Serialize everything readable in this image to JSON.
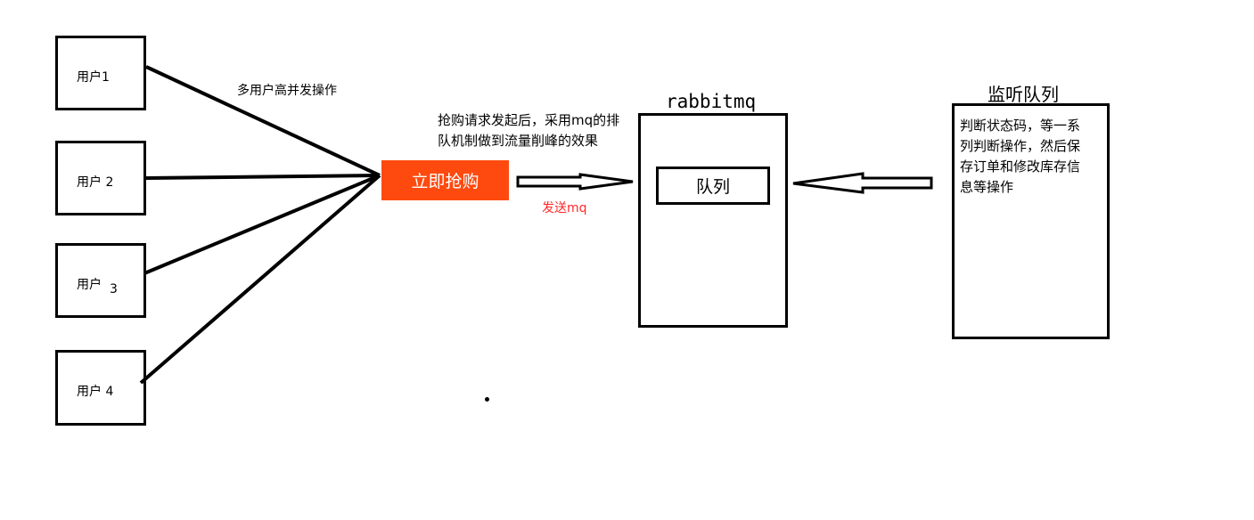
{
  "users": [
    {
      "label": "用户1"
    },
    {
      "label": "用户 2"
    },
    {
      "label": "用户",
      "suffix": "3"
    },
    {
      "label": "用户 4"
    }
  ],
  "concurrency_label": "多用户高并发操作",
  "buy_button_label": "立即抢购",
  "request_note": [
    "抢购请求发起后，采用mq的排",
    "队机制做到流量削峰的效果"
  ],
  "send_mq_label": "发送mq",
  "rabbitmq": {
    "title": "rabbitmq",
    "queue_label": "队列"
  },
  "listener": {
    "title": "监听队列",
    "description": [
      "判断状态码，等一系",
      "列判断操作，然后保",
      "存订单和修改库存信",
      "息等操作"
    ]
  },
  "colors": {
    "button": "#ff4a0f",
    "send_mq_text": "#ff2a2a"
  }
}
